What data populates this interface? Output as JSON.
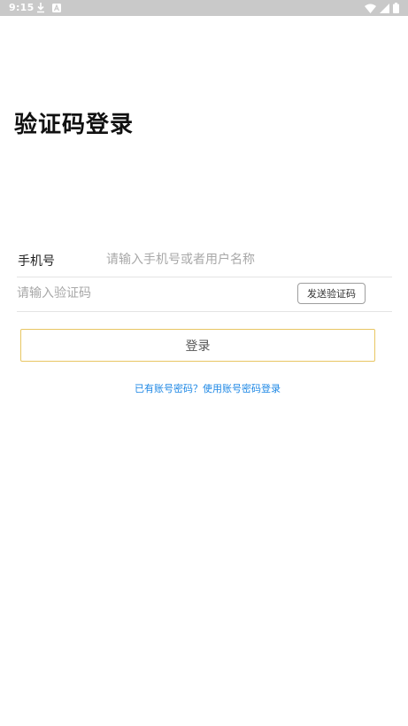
{
  "status_bar": {
    "time": "9:15",
    "left_icons": [
      "download-icon",
      "a-box-icon"
    ],
    "right_icons": [
      "wifi-icon",
      "signal-icon",
      "battery-icon"
    ]
  },
  "page": {
    "title": "验证码登录"
  },
  "form": {
    "phone_label": "手机号",
    "phone_placeholder": "请输入手机号或者用户名称",
    "phone_value": "",
    "code_placeholder": "请输入验证码",
    "code_value": "",
    "send_code_label": "发送验证码"
  },
  "actions": {
    "login_label": "登录",
    "password_login_link": "已有账号密码？使用账号密码登录"
  },
  "colors": {
    "status_bar_bg": "#c9c9c9",
    "login_border": "#e8c662",
    "link": "#1e88e5"
  }
}
